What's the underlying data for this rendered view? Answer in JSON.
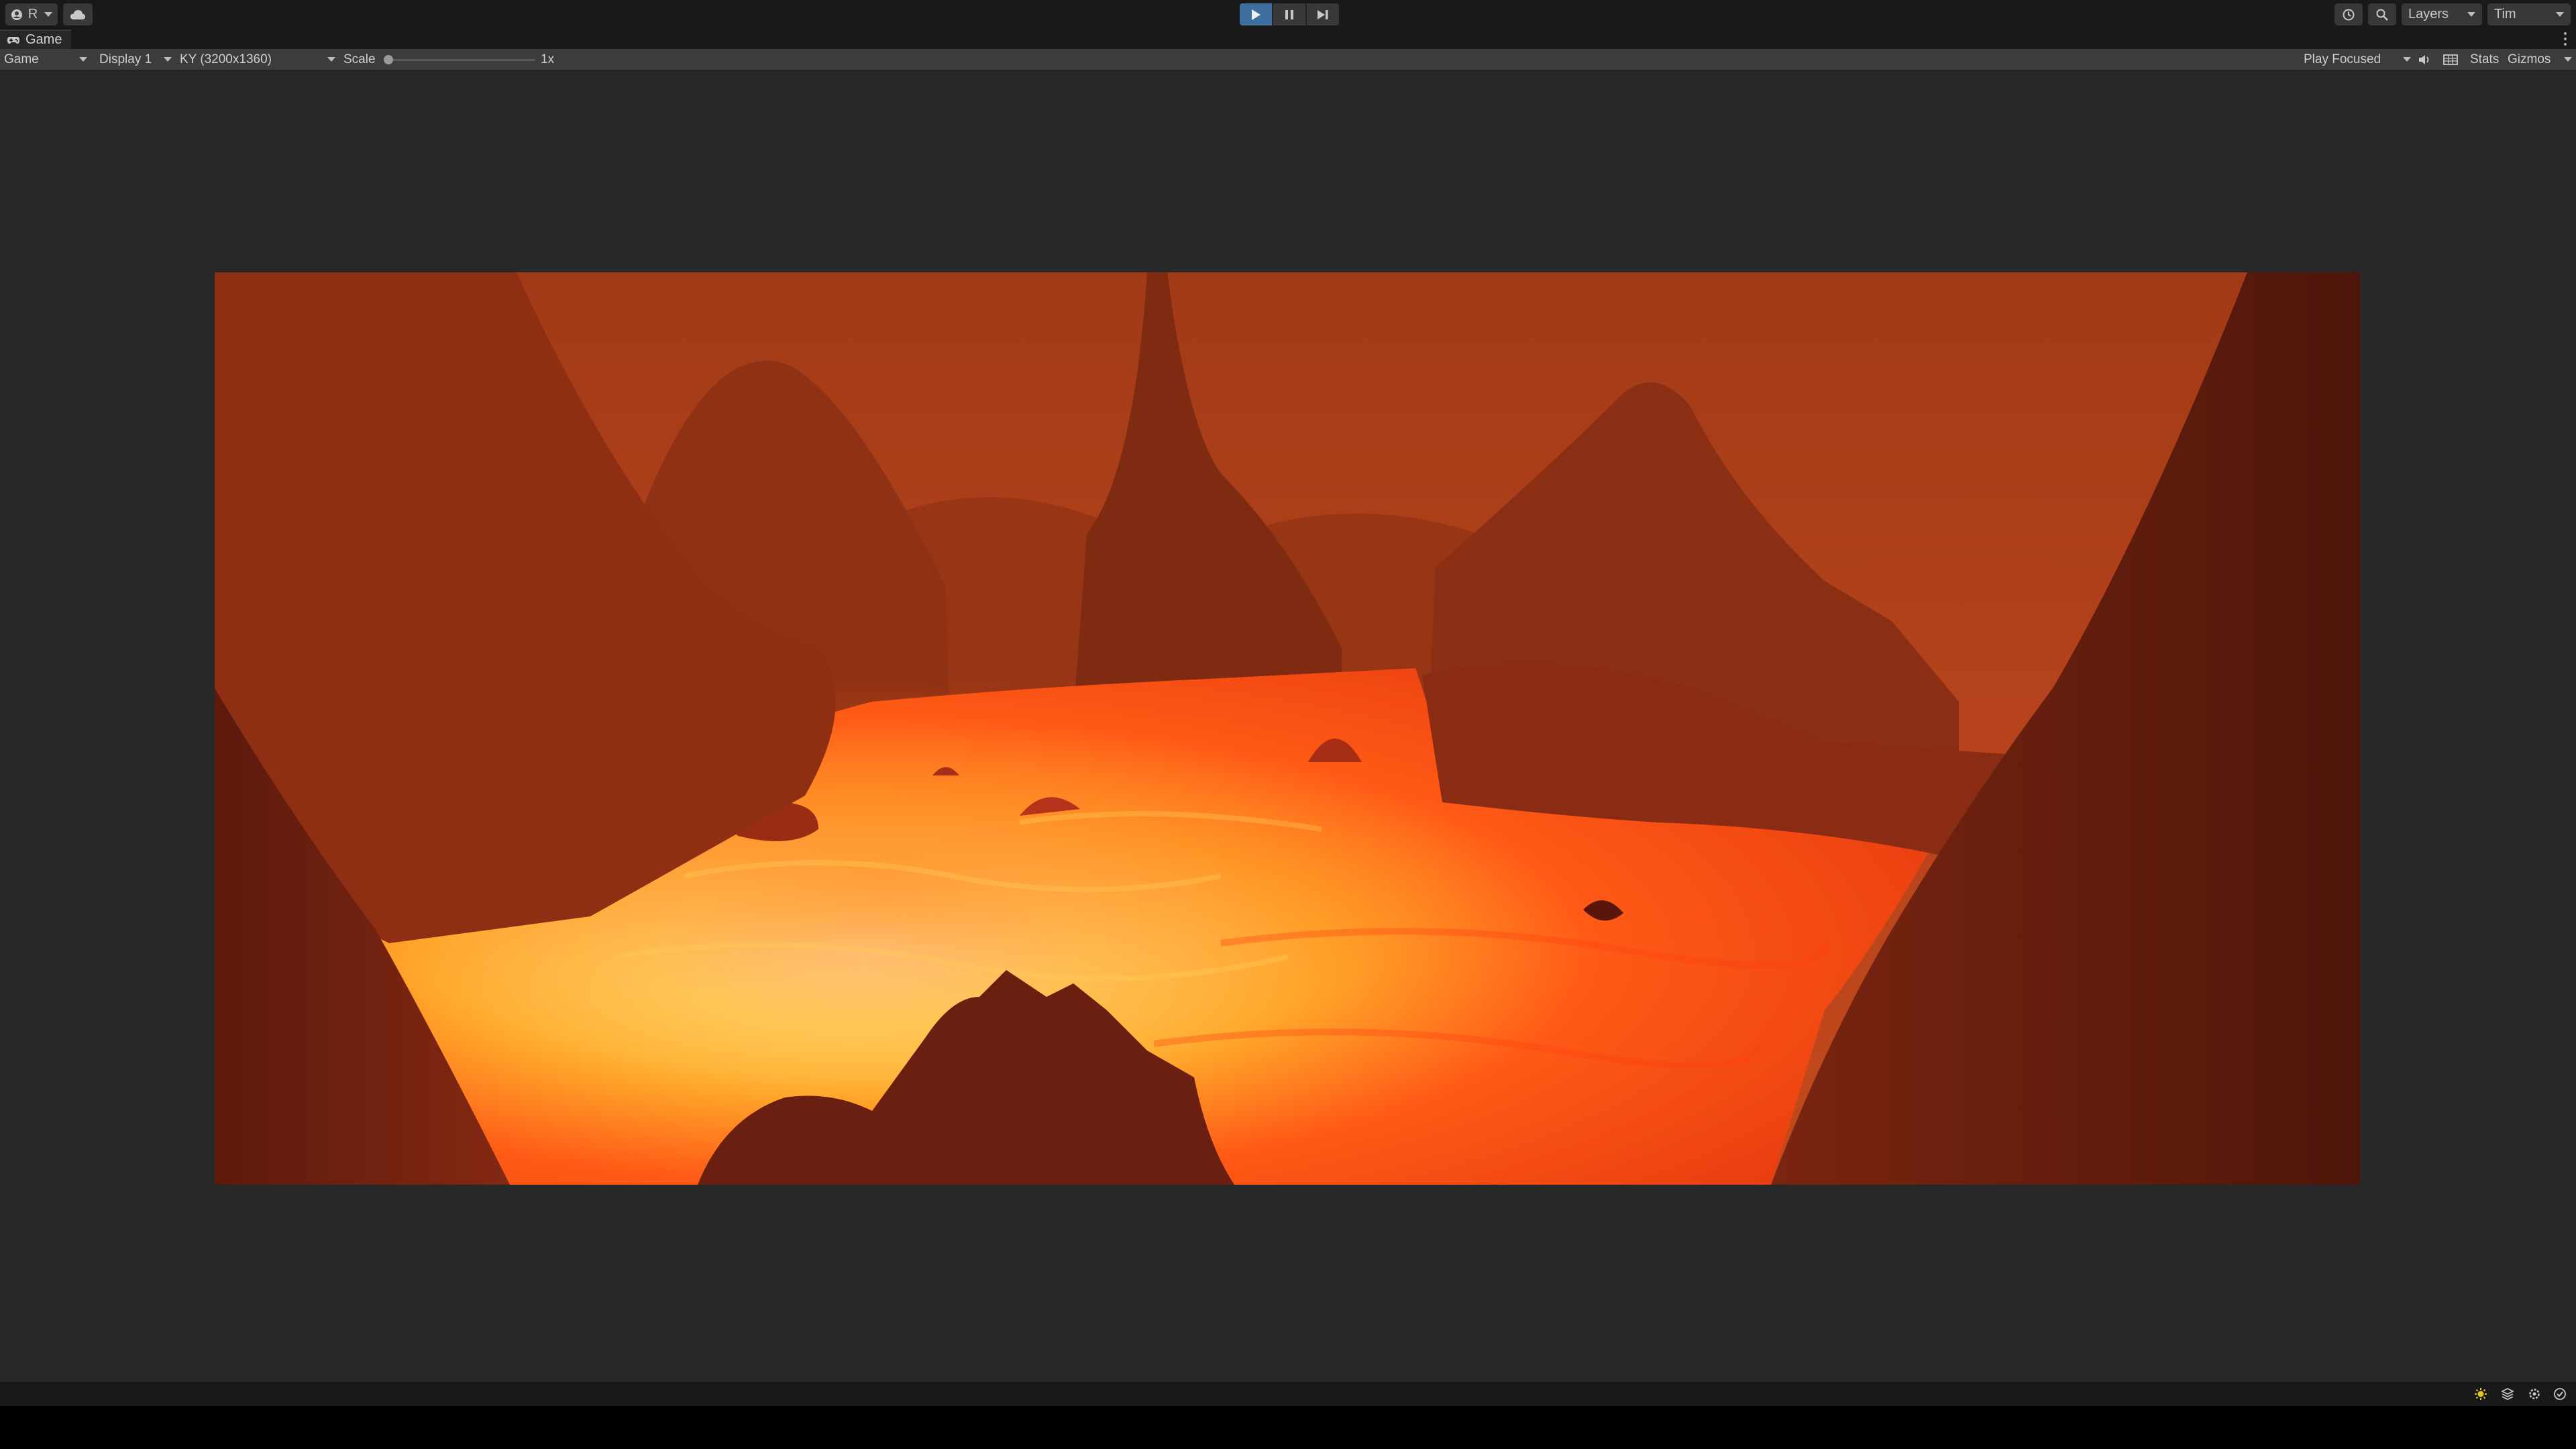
{
  "toolbar": {
    "account_label": "R",
    "layers_label": "Layers",
    "user_label": "Tim"
  },
  "tab": {
    "title": "Game"
  },
  "game_toolbar": {
    "mode": "Game",
    "display": "Display 1",
    "resolution": "KY (3200x1360)",
    "scale_label": "Scale",
    "scale_value": "1x",
    "play_mode": "Play Focused",
    "stats_label": "Stats",
    "gizmos_label": "Gizmos"
  },
  "colors": {
    "play_active": "#3f6f9e",
    "sky": "#b6431c",
    "lava_hot": "#fff5a0",
    "lava_mid": "#ff6a1a",
    "rock": "#6a1f10"
  },
  "icons": [
    "account-icon",
    "cloud-icon",
    "play-icon",
    "pause-icon",
    "step-icon",
    "history-icon",
    "search-icon",
    "game-controller-icon",
    "kebab-menu-icon",
    "mute-icon",
    "gizmo-grid-icon",
    "light-icon",
    "layers-stack-icon",
    "settings-icon",
    "checkmark-icon"
  ]
}
